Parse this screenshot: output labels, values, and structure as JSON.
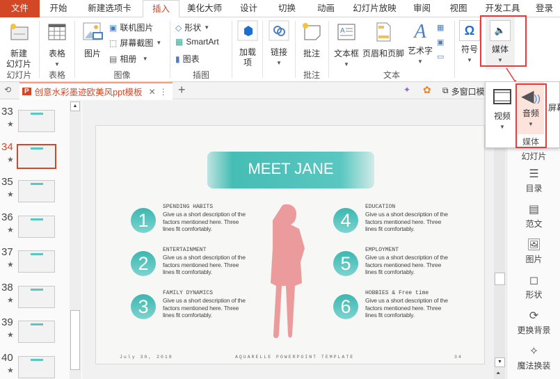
{
  "tabs": [
    "文件",
    "开始",
    "新建选项卡",
    "插入",
    "美化大师",
    "设计",
    "切换",
    "动画",
    "幻灯片放映",
    "审阅",
    "视图",
    "开发工具",
    "登录"
  ],
  "active_tab": "插入",
  "ribbon": {
    "new_slide": "新建\n幻灯片",
    "table": "表格",
    "picture": "图片",
    "online_picture": "联机图片",
    "screenshot": "屏幕截图",
    "album": "相册",
    "shapes": "形状",
    "smartart": "SmartArt",
    "chart": "图表",
    "addins": "加载\n项",
    "link": "链接",
    "comment": "批注",
    "textbox": "文本框",
    "header_footer": "页眉和页脚",
    "wordart": "艺术字",
    "symbol": "符号",
    "media": "媒体",
    "groups": {
      "slides": "幻灯片",
      "tables": "表格",
      "images": "图像",
      "illustrations": "插图",
      "comments": "批注",
      "text": "文本"
    }
  },
  "doc_tab": {
    "title": "创意水彩墨迹欧美风ppt模板",
    "multiwindow": "多窗口模"
  },
  "media_popup": {
    "video": "视频",
    "audio": "音频",
    "screen_rec": "屏幕录",
    "group": "媒体"
  },
  "slides": [
    {
      "n": "33"
    },
    {
      "n": "34",
      "selected": true
    },
    {
      "n": "35"
    },
    {
      "n": "36"
    },
    {
      "n": "37"
    },
    {
      "n": "38"
    },
    {
      "n": "39"
    },
    {
      "n": "40"
    }
  ],
  "slide": {
    "title": "MEET JANE",
    "items": [
      {
        "num": "1",
        "head": "SPENDING HABITS",
        "desc": "Give us a short description of the factors mentioned here. Three lines fit comfortably."
      },
      {
        "num": "2",
        "head": "ENTERTAINMENT",
        "desc": "Give us a short description of the factors mentioned here. Three lines fit comfortably."
      },
      {
        "num": "3",
        "head": "FAMILY DYNAMICS",
        "desc": "Give us a short description of the factors mentioned here. Three lines fit comfortably."
      },
      {
        "num": "4",
        "head": "EDUCATION",
        "desc": "Give us a short description of the factors mentioned here. Three lines fit comfortably."
      },
      {
        "num": "5",
        "head": "EMPLOYMENT",
        "desc": "Give us a short description of the factors mentioned here. Three lines fit comfortably."
      },
      {
        "num": "6",
        "head": "HOBBIES & Free time",
        "desc": "Give us a short description of the factors mentioned here. Three lines fit comfortably."
      }
    ],
    "footer_date": "July 30, 2018",
    "footer_center": "AQUARELLE POWERPOINT TEMPLATE",
    "footer_page": "34"
  },
  "right_panel": [
    "幻灯片",
    "目录",
    "范文",
    "图片",
    "形状",
    "更换背景",
    "魔法换装"
  ],
  "colors": {
    "accent": "#d24726",
    "teal": "#3bb7b0",
    "silhouette": "#e98b8b",
    "highlight": "#e8393b"
  }
}
